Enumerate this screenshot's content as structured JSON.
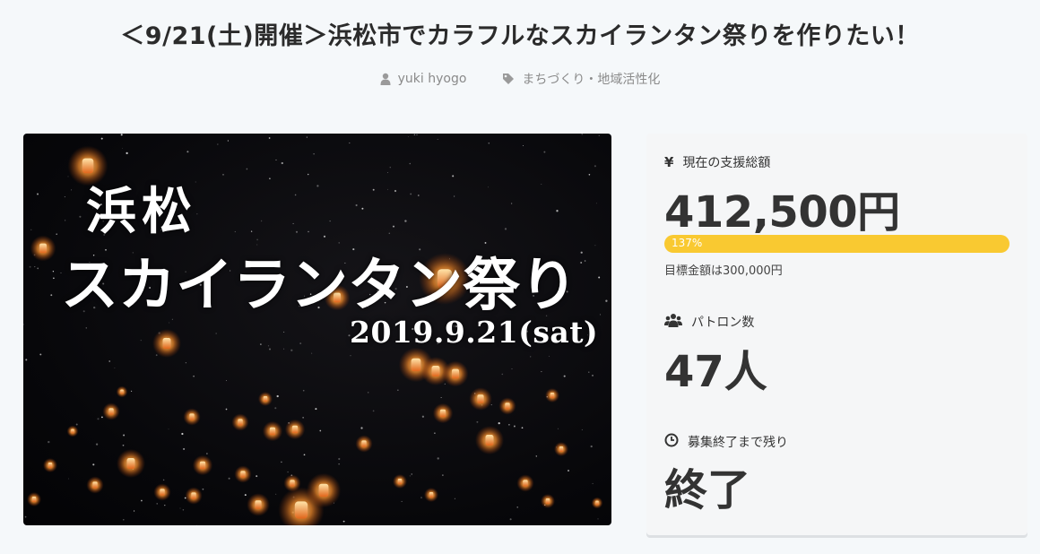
{
  "project": {
    "title": "＜9/21(土)開催＞浜松市でカラフルなスカイランタン祭りを作りたい！",
    "author": "yuki hyogo",
    "category": "まちづくり・地域活性化"
  },
  "hero": {
    "line1": "浜松",
    "line2": "スカイランタン祭り",
    "line3": "2019.9.21(sat)"
  },
  "stats": {
    "funding_label": "現在の支援総額",
    "funding_amount": "412,500円",
    "progress_text": "137%",
    "progress_fraction": 1.0,
    "goal_text": "目標金額は300,000円",
    "patrons_label": "パトロン数",
    "patrons_count": "47人",
    "remaining_label": "募集終了まで残り",
    "remaining_value": "終了"
  },
  "colors": {
    "progress": "#f9c931",
    "background": "#f5f8fa",
    "panel": "#f5f6f7"
  },
  "icons": {
    "author": "user-icon",
    "category": "tag-icon",
    "funding": "yen-icon",
    "patrons": "users-icon",
    "remaining": "clock-icon"
  }
}
